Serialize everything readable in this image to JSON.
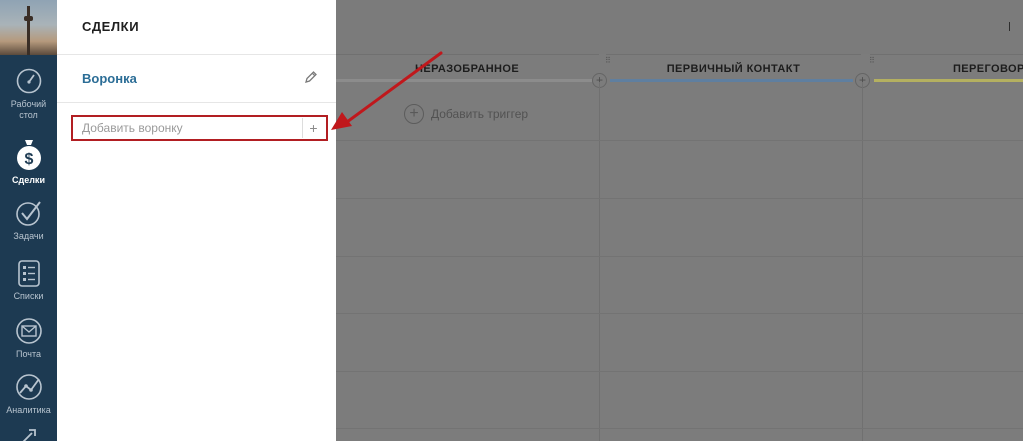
{
  "nav": {
    "items": [
      {
        "label": "Рабочий\nстол",
        "icon": "speedometer-icon"
      },
      {
        "label": "Сделки",
        "icon": "dollar-bag-icon",
        "active": true
      },
      {
        "label": "Задачи",
        "icon": "checkmark-icon"
      },
      {
        "label": "Списки",
        "icon": "list-icon"
      },
      {
        "label": "Почта",
        "icon": "mail-icon"
      },
      {
        "label": "Аналитика",
        "icon": "chart-icon"
      }
    ]
  },
  "panel": {
    "title": "СДЕЛКИ",
    "pipeline": "Воронка",
    "add_placeholder": "Добавить воронку",
    "add_plus": "+"
  },
  "board": {
    "columns": [
      {
        "title": "НЕРАЗОБРАННОЕ",
        "color": "#8c8c8c"
      },
      {
        "title": "ПЕРВИЧНЫЙ КОНТАКТ",
        "color": "#5f7fa0"
      },
      {
        "title": "ПЕРЕГОВОРЫ",
        "color": "#b4b060"
      }
    ],
    "add_trigger": "Добавить триггер",
    "plus": "+"
  },
  "colors": {
    "nav_bg": "#1d3a52",
    "accent_link": "#2b6d96",
    "highlight_red": "#b21e22",
    "overlay": "#7c7c7c"
  }
}
